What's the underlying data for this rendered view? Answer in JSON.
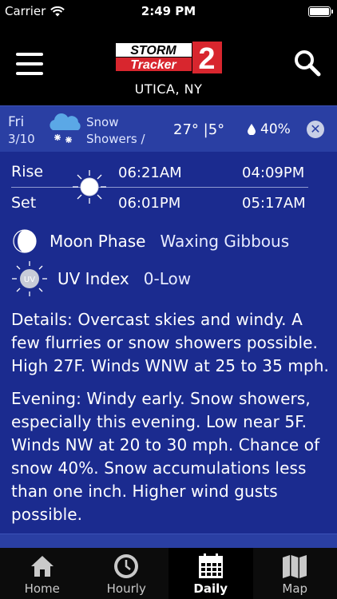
{
  "status_bar": {
    "carrier": "Carrier",
    "time": "2:49 PM"
  },
  "header": {
    "logo": {
      "line1": "STORM",
      "line2": "Tracker",
      "number": "2"
    },
    "location": "UTICA, NY"
  },
  "forecast_strip": {
    "day": "Fri",
    "date": "3/10",
    "condition_line1": "Snow",
    "condition_line2": "Showers /",
    "temps": "27° |5°",
    "precip": "40%",
    "close_glyph": "✕"
  },
  "sun_moon": {
    "rise_label": "Rise",
    "set_label": "Set",
    "sunrise": "06:21AM",
    "sunset": "06:01PM",
    "moonrise": "04:09PM",
    "moonset": "05:17AM"
  },
  "moon_phase": {
    "label": "Moon Phase",
    "value": "Waxing Gibbous"
  },
  "uv_index": {
    "label": "UV Index",
    "value": "0-Low",
    "icon_text": "UV"
  },
  "details": {
    "day": "Details: Overcast skies and windy. A few flurries or snow showers possible. High 27F. Winds WNW at 25 to 35 mph.",
    "evening": "Evening: Windy early. Snow showers, especially this evening. Low near 5F. Winds NW at 20 to 30 mph. Chance of snow 40%. Snow accumulations less than one inch. Higher wind gusts possible."
  },
  "tabs": [
    {
      "label": "Home",
      "icon": "home-icon",
      "active": false
    },
    {
      "label": "Hourly",
      "icon": "clock-icon",
      "active": false
    },
    {
      "label": "Daily",
      "icon": "calendar-icon",
      "active": true
    },
    {
      "label": "Map",
      "icon": "map-icon",
      "active": false
    }
  ],
  "colors": {
    "background": "#1b2b8f",
    "strip": "#2a3fa3",
    "logo_red": "#d8262e",
    "header": "#000000"
  }
}
